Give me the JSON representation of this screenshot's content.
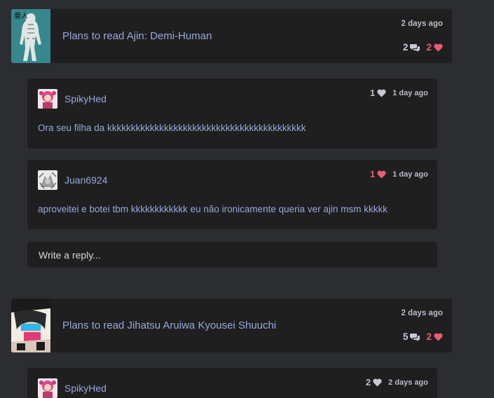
{
  "activities": [
    {
      "status": "Plans to read Ajin: Demi-Human",
      "time": "2 days ago",
      "reply_count": "2",
      "like_count": "2",
      "cover_icon": "manga-cover-ajin"
    },
    {
      "status": "Plans to read Jihatsu Aruiwa Kyousei Shuuchi",
      "time": "2 days ago",
      "reply_count": "5",
      "like_count": "2",
      "cover_icon": "manga-cover-jihatsu"
    }
  ],
  "replies": [
    {
      "user": "SpikyHed",
      "likes": "1",
      "liked": false,
      "time": "1 day ago",
      "text": "Ora seu filha da kkkkkkkkkkkkkkkkkkkkkkkkkkkkkkkkkkkkkkkkkk"
    },
    {
      "user": "Juan6924",
      "likes": "1",
      "liked": true,
      "time": "1 day ago",
      "text": "aproveitei e botei tbm kkkkkkkkkkkk eu não ironicamente queria ver ajin msm kkkkk"
    },
    {
      "user": "SpikyHed",
      "likes": "2",
      "liked": false,
      "time": "2 days ago",
      "text": ""
    }
  ],
  "reply_input": {
    "placeholder": "Write a reply..."
  },
  "colors": {
    "background": "#2b2d31",
    "card": "#1f1f20",
    "link": "#9aa7d8",
    "like": "#e85d75"
  }
}
